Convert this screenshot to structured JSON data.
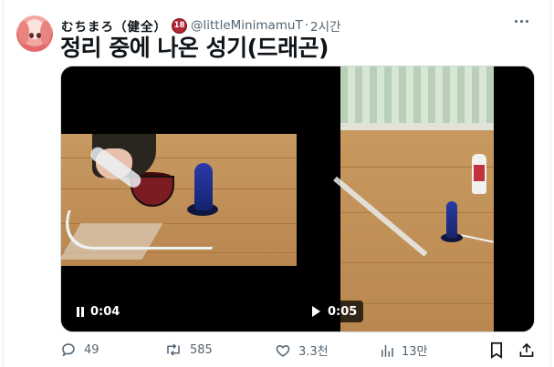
{
  "post": {
    "author_name": "むちまろ（健全）",
    "badge": "18",
    "handle": "@littleMinimamuT",
    "separator": "·",
    "time": "2시간",
    "text": "정리 중에 나온 성기(드래곤)"
  },
  "media": [
    {
      "label": "0:04",
      "state": "playing"
    },
    {
      "label": "0:05",
      "state": "paused"
    }
  ],
  "actions": {
    "replies": "49",
    "reposts": "585",
    "likes": "3.3천",
    "views": "13만"
  }
}
